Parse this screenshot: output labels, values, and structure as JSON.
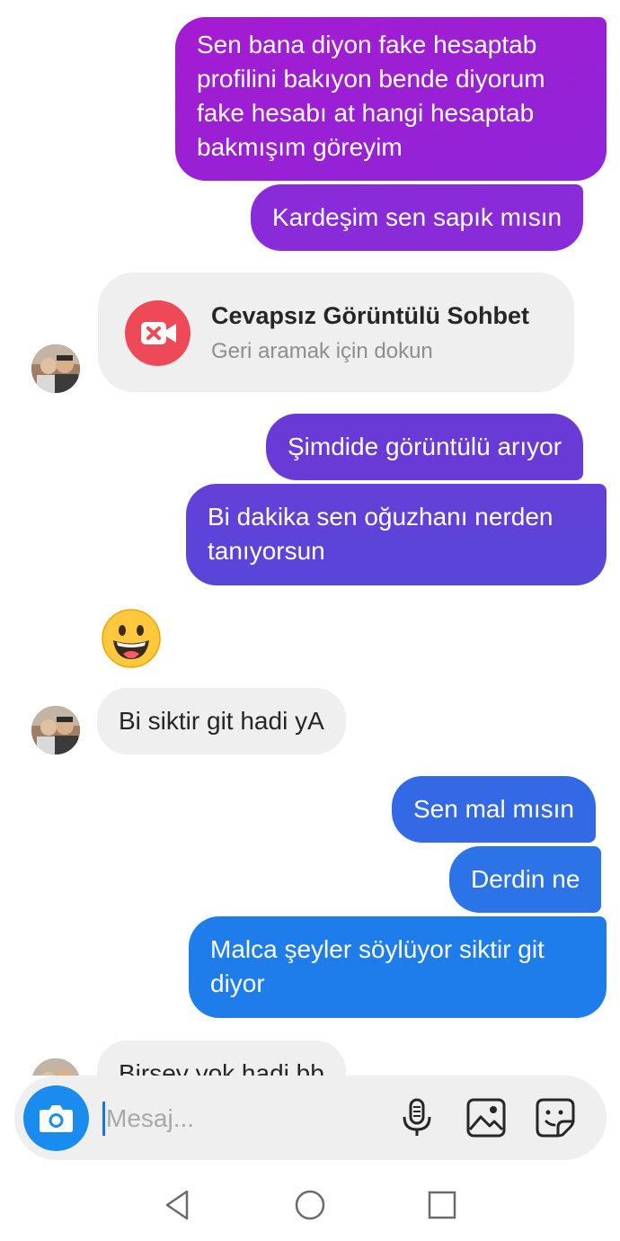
{
  "messages": {
    "m1": "Sen bana diyon fake hesaptab profilini bakıyon bende diyorum fake hesabı at hangi hesaptab bakmışım göreyim",
    "m2": "Kardeşim sen sapık mısın",
    "m3": "Şimdide görüntülü arıyor",
    "m4": "Bi dakika sen oğuzhanı nerden tanıyorsun",
    "m5": "Bi siktir git hadi yA",
    "m6": "Sen mal mısın",
    "m7": "Derdin ne",
    "m8": "Malca şeyler söylüyor siktir git diyor",
    "m9": "Birşey yok hadi bb"
  },
  "missed_call": {
    "title": "Cevapsız Görüntülü Sohbet",
    "subtitle": "Geri aramak için dokun",
    "icon": "video-camera-missed-icon"
  },
  "emoji": "grinning-face-icon",
  "composer": {
    "placeholder": "Mesaj...",
    "icons": [
      "camera-icon",
      "microphone-icon",
      "gallery-icon",
      "sticker-icon"
    ]
  },
  "navigation": [
    "back-icon",
    "home-icon",
    "recents-icon"
  ],
  "colors": {
    "gradient_top": "#9b1fd6",
    "gradient_mid": "#5b45d9",
    "gradient_bottom": "#1f7ceb",
    "incoming_bubble": "#efefef",
    "missed_call_red": "#ed4956",
    "camera_button": "#1a8cf0"
  }
}
